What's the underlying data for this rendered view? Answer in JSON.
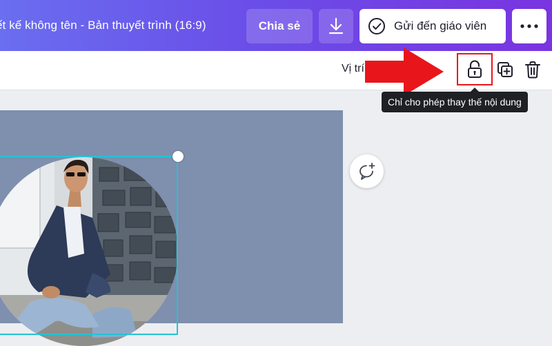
{
  "header": {
    "doc_title": "ết kế không tên - Bản thuyết trình (16:9)",
    "share_label": "Chia sẻ",
    "send_label": "Gửi đến giáo viên",
    "download_icon": "download-icon",
    "more_icon": "more-horizontal-icon",
    "send_icon": "check-circle-icon"
  },
  "toolbar": {
    "position_label": "Vị trí",
    "lock_icon": "unlock-icon",
    "duplicate_icon": "duplicate-icon",
    "delete_icon": "trash-icon"
  },
  "tooltip": {
    "text": "Chỉ cho phép thay thế nội dung"
  },
  "colors": {
    "header_start": "#6a6ef0",
    "header_end": "#7a34e0",
    "highlight_red": "#e8161b",
    "selection_cyan": "#22c4d6",
    "canvas_page": "#7f8fae",
    "workspace": "#eceef1"
  }
}
